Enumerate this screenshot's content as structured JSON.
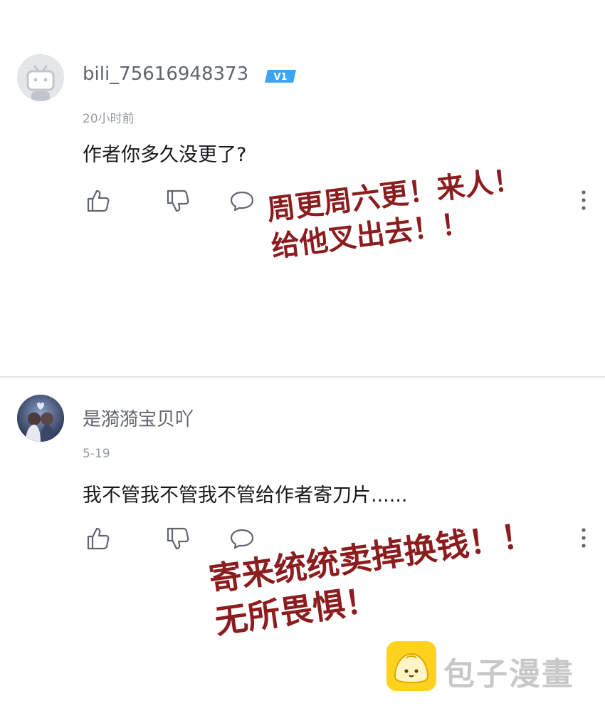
{
  "comments": [
    {
      "username": "bili_75616948373",
      "level": "V1",
      "time": "20小时前",
      "content": "作者你多久没更了?",
      "annotation": [
        "周更周六更！来人！",
        "给他叉出去！！"
      ]
    },
    {
      "username": "是漪漪宝贝吖",
      "time": "5-19",
      "content": "我不管我不管我不管给作者寄刀片......",
      "annotation": [
        "寄来统统卖掉换钱！！",
        "无所畏惧！"
      ]
    }
  ],
  "watermark": {
    "text": "包子漫畫"
  },
  "icons": {
    "like": "thumb-up-icon",
    "dislike": "thumb-down-icon",
    "reply": "comment-bubble-icon",
    "more": "more-vertical-icon"
  },
  "colors": {
    "annotation": "#8c1d1f",
    "level_badge": "#3da3f5",
    "watermark_logo": "#ffd21e"
  }
}
